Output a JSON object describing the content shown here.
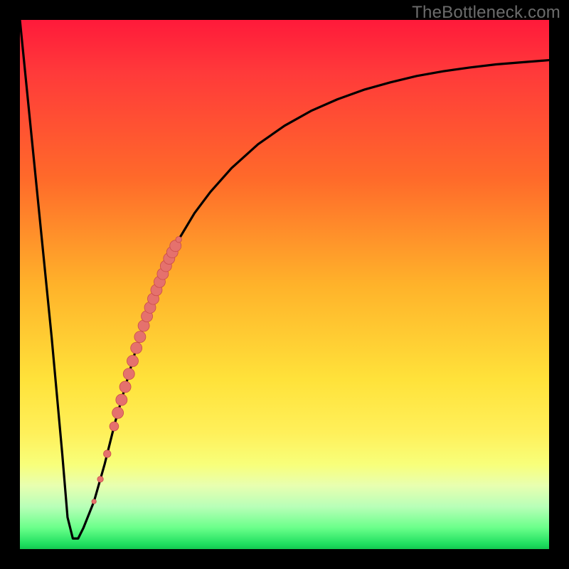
{
  "watermark": "TheBottleneck.com",
  "colors": {
    "background": "#000000",
    "curve": "#000000",
    "marker_fill": "#E5716D",
    "marker_stroke": "#C94C4A"
  },
  "chart_data": {
    "type": "line",
    "title": "",
    "xlabel": "",
    "ylabel": "",
    "xlim": [
      0,
      100
    ],
    "ylim": [
      0,
      100
    ],
    "series": [
      {
        "name": "curve",
        "x": [
          0,
          2,
          4,
          6,
          8,
          9,
          10,
          11,
          12,
          14,
          16,
          18,
          20,
          22,
          24,
          26,
          28,
          30,
          33,
          36,
          40,
          45,
          50,
          55,
          60,
          65,
          70,
          75,
          80,
          85,
          90,
          95,
          100
        ],
        "y": [
          100,
          80,
          60,
          40,
          18,
          6,
          2,
          2,
          4,
          9,
          16,
          24,
          31,
          38,
          44,
          49.5,
          54.5,
          58.5,
          63.5,
          67.5,
          72,
          76.5,
          80,
          82.8,
          85,
          86.8,
          88.2,
          89.4,
          90.3,
          91,
          91.6,
          92,
          92.4
        ]
      }
    ],
    "marker_band": {
      "name": "highlight",
      "radius_min": 3.2,
      "radius_max": 8.0,
      "points_x": [
        14.0,
        15.2,
        16.5,
        17.8,
        18.5,
        19.2,
        19.9,
        20.6,
        21.3,
        22.0,
        22.7,
        23.4,
        24.0,
        24.6,
        25.2,
        25.8,
        26.4,
        27.0,
        27.6,
        28.2,
        28.8,
        29.4,
        30.0
      ]
    }
  }
}
